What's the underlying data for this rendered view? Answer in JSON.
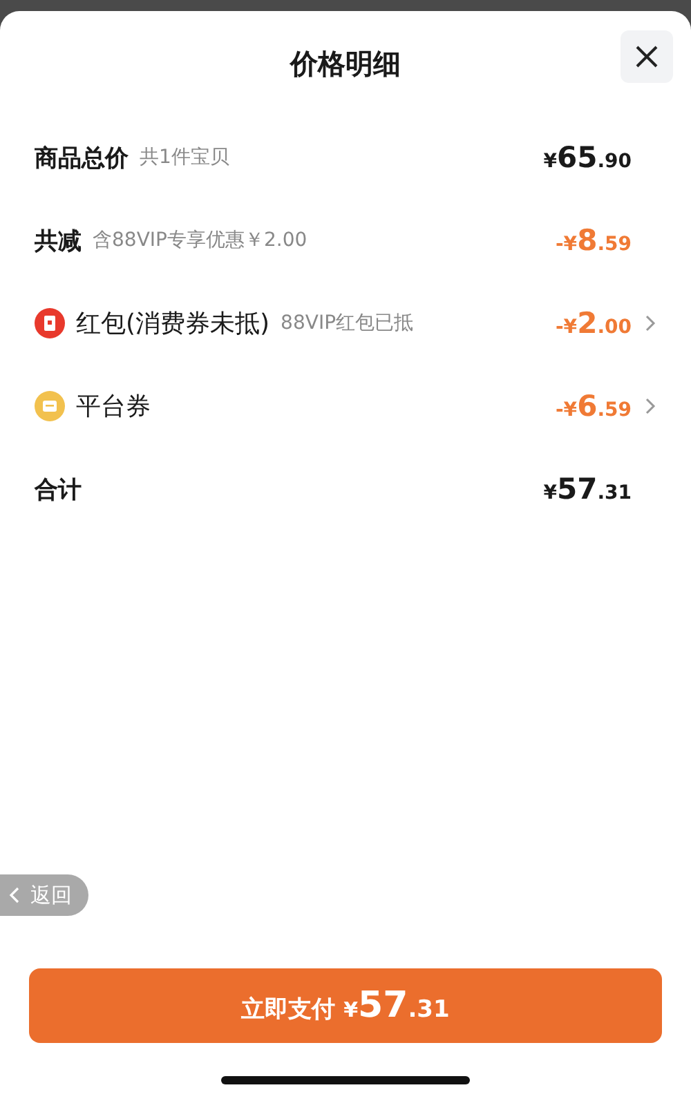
{
  "title": "价格明细",
  "rows": [
    {
      "kind": "plain",
      "label": "商品总价",
      "bold": true,
      "note": "共1件宝贝",
      "discount": false,
      "arrow": false,
      "price": {
        "sign": "¥",
        "int": "65",
        "dec": ".90"
      }
    },
    {
      "kind": "plain",
      "label": "共减",
      "bold": true,
      "note": "含88VIP专享优惠￥2.00",
      "discount": true,
      "arrow": false,
      "price": {
        "sign": "-¥",
        "int": "8",
        "dec": ".59"
      }
    },
    {
      "kind": "red-packet",
      "label": "红包(消费券未抵)",
      "bold": false,
      "note": "88VIP红包已抵",
      "discount": true,
      "arrow": true,
      "price": {
        "sign": "-¥",
        "int": "2",
        "dec": ".00"
      }
    },
    {
      "kind": "coupon",
      "label": "平台券",
      "bold": false,
      "discount": true,
      "arrow": true,
      "price": {
        "sign": "-¥",
        "int": "6",
        "dec": ".59"
      }
    },
    {
      "kind": "plain",
      "label": "合计",
      "bold": true,
      "discount": false,
      "arrow": false,
      "price": {
        "sign": "¥",
        "int": "57",
        "dec": ".31"
      }
    }
  ],
  "back": "返回",
  "pay": {
    "label": "立即支付",
    "sign": "¥",
    "int": "57",
    "dec": ".31"
  }
}
